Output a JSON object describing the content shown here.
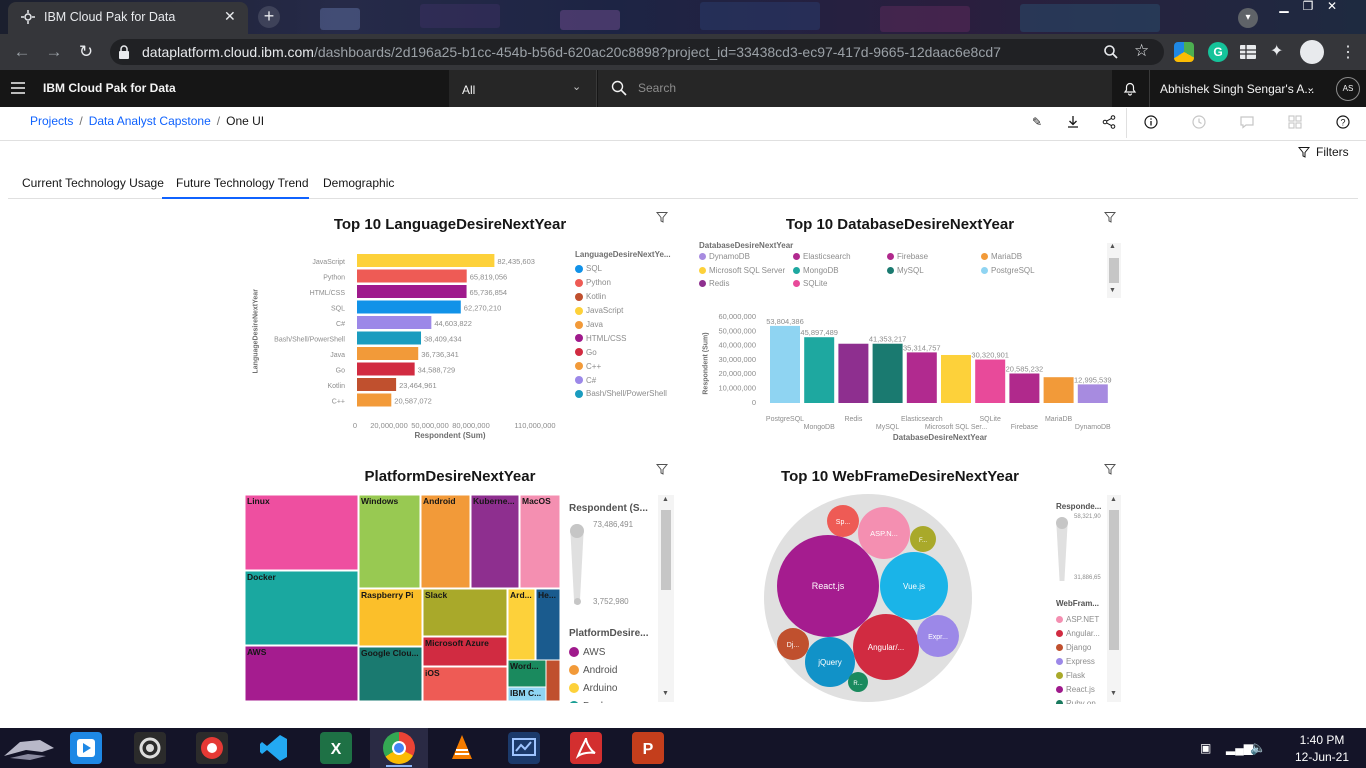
{
  "browser": {
    "tab_title": "IBM Cloud Pak for Data",
    "url_host": "dataplatform.cloud.ibm.com",
    "url_path": "/dashboards/2d196a25-b1cc-454b-b56d-620ac20c8898?project_id=33438cd3-ec97-417d-9665-12daac6e8cd7"
  },
  "app": {
    "brand": "IBM Cloud Pak for Data",
    "scope": "All",
    "search_placeholder": "Search",
    "user": "Abhishek Singh Sengar's A...",
    "avatar": "AS"
  },
  "breadcrumb": {
    "projects": "Projects",
    "project": "Data Analyst Capstone",
    "current": "One UI"
  },
  "filters_label": "Filters",
  "tabs": [
    "Current Technology Usage",
    "Future Technology Trend",
    "Demographic"
  ],
  "colors": {
    "SQL": "#1192e8",
    "Python": "#ee5b55",
    "Kotlin": "#c0502e",
    "JavaScript": "#fdd13a",
    "Java": "#f29a39",
    "HTML/CSS": "#9f1a8c",
    "Go": "#d12b41",
    "C++": "#f29a39",
    "C#": "#9c88e8",
    "Bash": "#1a9cbf",
    "accent": "#0f62fe"
  },
  "language_chart": {
    "title": "Top 10 LanguageDesireNextYear",
    "ylabel": "LanguageDesireNextYear",
    "xlabel": "Respondent (Sum)",
    "xticks": [
      "0",
      "20,000,000",
      "50,000,000",
      "80,000,000",
      "110,000,000"
    ],
    "legend_title": "LanguageDesireNextYe...",
    "legend": [
      "SQL",
      "Python",
      "Kotlin",
      "JavaScript",
      "Java",
      "HTML/CSS",
      "Go",
      "C++",
      "C#",
      "Bash/Shell/PowerShell"
    ]
  },
  "database_chart": {
    "title": "Top 10 DatabaseDesireNextYear",
    "legend_title": "DatabaseDesireNextYear",
    "legend": [
      "DynamoDB",
      "Elasticsearch",
      "Firebase",
      "MariaDB",
      "Microsoft SQL Server",
      "MongoDB",
      "MySQL",
      "PostgreSQL",
      "Redis",
      "SQLite"
    ],
    "ylabel": "Respondent (Sum)",
    "xlabel": "DatabaseDesireNextYear",
    "yticks": [
      "60,000,000",
      "50,000,000",
      "40,000,000",
      "30,000,000",
      "20,000,000",
      "10,000,000",
      "0"
    ],
    "xlabels": [
      "PostgreSQL",
      "MongoDB",
      "Redis",
      "MySQL",
      "Elasticsearch",
      "Microsoft SQL Ser...",
      "SQLite",
      "Firebase",
      "MariaDB",
      "DynamoDB"
    ]
  },
  "platform_chart": {
    "title": "PlatformDesireNextYear",
    "size_title": "Respondent (S...",
    "size_max": "73,486,491",
    "size_min": "3,752,980",
    "legend_title": "PlatformDesire...",
    "legend": [
      "AWS",
      "Android",
      "Arduino",
      "Docker"
    ],
    "legend_colors": [
      "#9f1a8c",
      "#f29a39",
      "#fdd13a",
      "#1a9e94"
    ]
  },
  "webframe_chart": {
    "title": "Top 10 WebFrameDesireNextYear",
    "size_title": "Responde...",
    "size_max": "58,321,90",
    "size_min": "31,886,65",
    "legend_title": "WebFram...",
    "legend": [
      "ASP.NET",
      "Angular...",
      "Django",
      "Express",
      "Flask",
      "React.js",
      "Ruby on..."
    ],
    "legend_colors": [
      "#f48fb1",
      "#d12b41",
      "#c0502e",
      "#9c88e8",
      "#a9a92a",
      "#9f1a8c",
      "#1a7a5e"
    ]
  },
  "chart_data": [
    {
      "type": "bar",
      "title": "Top 10 LanguageDesireNextYear",
      "orientation": "horizontal",
      "categories": [
        "JavaScript",
        "Python",
        "HTML/CSS",
        "SQL",
        "C#",
        "Bash/Shell/PowerShell",
        "Java",
        "Go",
        "Kotlin",
        "C++"
      ],
      "values": [
        82435603,
        65819056,
        65736854,
        62270210,
        44603822,
        38409434,
        36736341,
        34588729,
        23464961,
        20587072
      ],
      "labels": [
        "82,435,603",
        "65,819,056",
        "65,736,854",
        "62,270,210",
        "44,603,822",
        "38,409,434",
        "36,736,341",
        "34,588,729",
        "23,464,961",
        "20,587,072"
      ],
      "colors": [
        "#fdd13a",
        "#ee5b55",
        "#9f1a8c",
        "#1192e8",
        "#9c88e8",
        "#1a9cbf",
        "#f29a39",
        "#d12b41",
        "#c0502e",
        "#f29a39"
      ],
      "xlabel": "Respondent (Sum)",
      "ylabel": "LanguageDesireNextYear",
      "xlim": [
        0,
        120000000
      ]
    },
    {
      "type": "bar",
      "title": "Top 10 DatabaseDesireNextYear",
      "categories": [
        "PostgreSQL",
        "MongoDB",
        "Redis",
        "MySQL",
        "Elasticsearch",
        "Microsoft SQL Server",
        "SQLite",
        "Firebase",
        "MariaDB",
        "DynamoDB"
      ],
      "values": [
        53804386,
        45897489,
        41353217,
        41353217,
        35314757,
        33500000,
        30320901,
        20585232,
        18000000,
        12995539
      ],
      "labels": [
        "53,804,386",
        "45,897,489",
        "",
        "41,353,217",
        "35,314,757",
        "",
        "30,320,901",
        "20,585,232",
        "",
        "12,995,539"
      ],
      "colors": [
        "#8fd4f2",
        "#1ea8a0",
        "#8e2f8f",
        "#1a7a70",
        "#b12a8f",
        "#fdd13a",
        "#e84a9a",
        "#b0298c",
        "#f29a39",
        "#a78be0"
      ],
      "xlabel": "DatabaseDesireNextYear",
      "ylabel": "Respondent (Sum)",
      "ylim": [
        0,
        60000000
      ]
    },
    {
      "type": "treemap",
      "title": "PlatformDesireNextYear",
      "items": [
        {
          "label": "Linux",
          "color": "#ee4fa0"
        },
        {
          "label": "Windows",
          "color": "#98c952"
        },
        {
          "label": "Android",
          "color": "#f29a39"
        },
        {
          "label": "Kuberne...",
          "color": "#8e2f8f"
        },
        {
          "label": "MacOS",
          "color": "#f48fb1"
        },
        {
          "label": "Docker",
          "color": "#1aa8a0"
        },
        {
          "label": "Raspberry Pi",
          "color": "#fbbf2a"
        },
        {
          "label": "Slack",
          "color": "#a9a92a"
        },
        {
          "label": "Ard...",
          "color": "#fdd13a"
        },
        {
          "label": "He...",
          "color": "#1a5b8e"
        },
        {
          "label": "AWS",
          "color": "#a51c8f"
        },
        {
          "label": "Google Clou...",
          "color": "#1a7a70"
        },
        {
          "label": "Microsoft Azure",
          "color": "#d12b41"
        },
        {
          "label": "iOS",
          "color": "#ee5b55"
        },
        {
          "label": "Word...",
          "color": "#1a8a5e"
        },
        {
          "label": "IBM C...",
          "color": "#8fd4f2"
        },
        {
          "label": "",
          "color": "#c0502e"
        }
      ]
    },
    {
      "type": "bubble",
      "title": "Top 10 WebFrameDesireNextYear",
      "items": [
        {
          "label": "React.js",
          "color": "#a51c8f"
        },
        {
          "label": "Angular/...",
          "color": "#d12b41"
        },
        {
          "label": "Vue.js",
          "color": "#1ab4e8"
        },
        {
          "label": "ASP.N...",
          "color": "#f48fb1"
        },
        {
          "label": "jQuery",
          "color": "#1192c8"
        },
        {
          "label": "Expr...",
          "color": "#9c88e8"
        },
        {
          "label": "Sp...",
          "color": "#ee5b55"
        },
        {
          "label": "Dj...",
          "color": "#c0502e"
        },
        {
          "label": "F...",
          "color": "#a9a92a"
        },
        {
          "label": "R...",
          "color": "#1a8a5e"
        }
      ]
    }
  ],
  "taskbar": {
    "time": "1:40 PM",
    "date": "12-Jun-21"
  }
}
